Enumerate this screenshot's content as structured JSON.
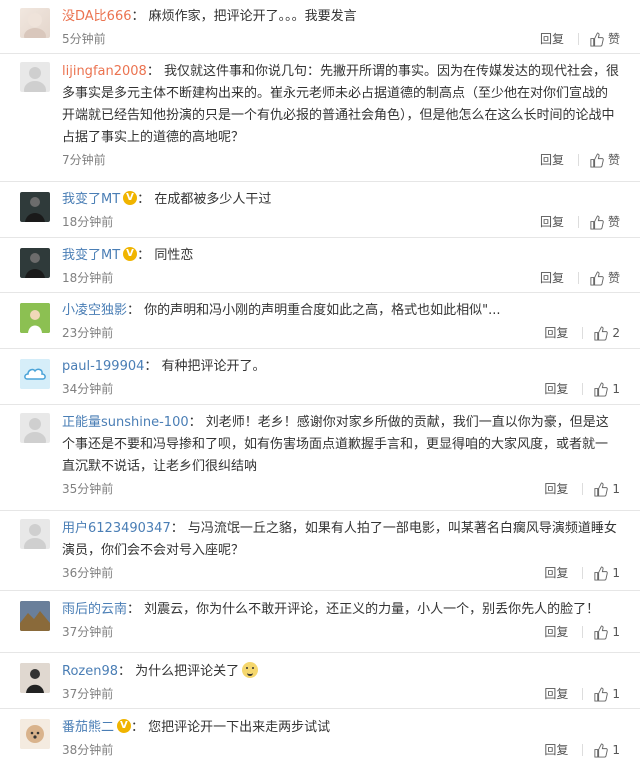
{
  "actions": {
    "reply": "回复",
    "like": "赞"
  },
  "comments": [
    {
      "user": "没DA比666",
      "text": "麻烦作家，把评论开了。。。我要发言",
      "time": "5分钟前",
      "likes": "赞"
    },
    {
      "user": "lijingfan2008",
      "text": "我仅就这件事和你说几句：先撇开所谓的事实。因为在传媒发达的现代社会，很多事实是多元主体不断建构出来的。崔永元老师未必占据道德的制高点（至少他在对你们宣战的开端就已经告知他扮演的只是一个有仇必报的普通社会角色），但是他怎么在这么长时间的论战中占据了事实上的道德的高地呢？",
      "time": "7分钟前",
      "likes": "赞"
    },
    {
      "user": "我变了MT",
      "text": "在成都被多少人干过",
      "time": "18分钟前",
      "likes": "赞"
    },
    {
      "user": "我变了MT",
      "text": "同性恋",
      "time": "18分钟前",
      "likes": "赞"
    },
    {
      "user": "小凌空独影",
      "text": "你的声明和冯小刚的声明重合度如此之高，格式也如此相似\"...",
      "time": "23分钟前",
      "likes": "2"
    },
    {
      "user": "paul-199904",
      "text": "有种把评论开了。",
      "time": "34分钟前",
      "likes": "1"
    },
    {
      "user": "正能量sunshine-100",
      "text": "刘老师！老乡！感谢你对家乡所做的贡献，我们一直以你为豪，但是这个事还是不要和冯导掺和了呗，如有伤害场面点道歉握手言和，更显得咱的大家风度，或者就一直沉默不说话，让老乡们很纠结呐",
      "time": "35分钟前",
      "likes": "1"
    },
    {
      "user": "用户6123490347",
      "text": "与冯流氓一丘之貉，如果有人拍了一部电影，叫某著名白瘸风导演频道睡女演员，你们会不会对号入座呢？",
      "time": "36分钟前",
      "likes": "1"
    },
    {
      "user": "雨后的云南",
      "text": "刘震云，你为什么不敢开评论，还正义的力量，小人一个，别丢你先人的脸了！",
      "time": "37分钟前",
      "likes": "1"
    },
    {
      "user": "Rozen98",
      "text": "为什么把评论关了",
      "time": "37分钟前",
      "likes": "1"
    },
    {
      "user": "番茄熊二",
      "text": "您把评论开一下出来走两步试试",
      "time": "38分钟前",
      "likes": "1"
    }
  ],
  "colors": {
    "username": "#eb7350",
    "time": "#808080",
    "divider": "#e6e6e6"
  },
  "icons": {
    "like": "thumbs-up-icon",
    "vip": "v-badge-icon",
    "emoji": "smile-emoji-icon"
  }
}
